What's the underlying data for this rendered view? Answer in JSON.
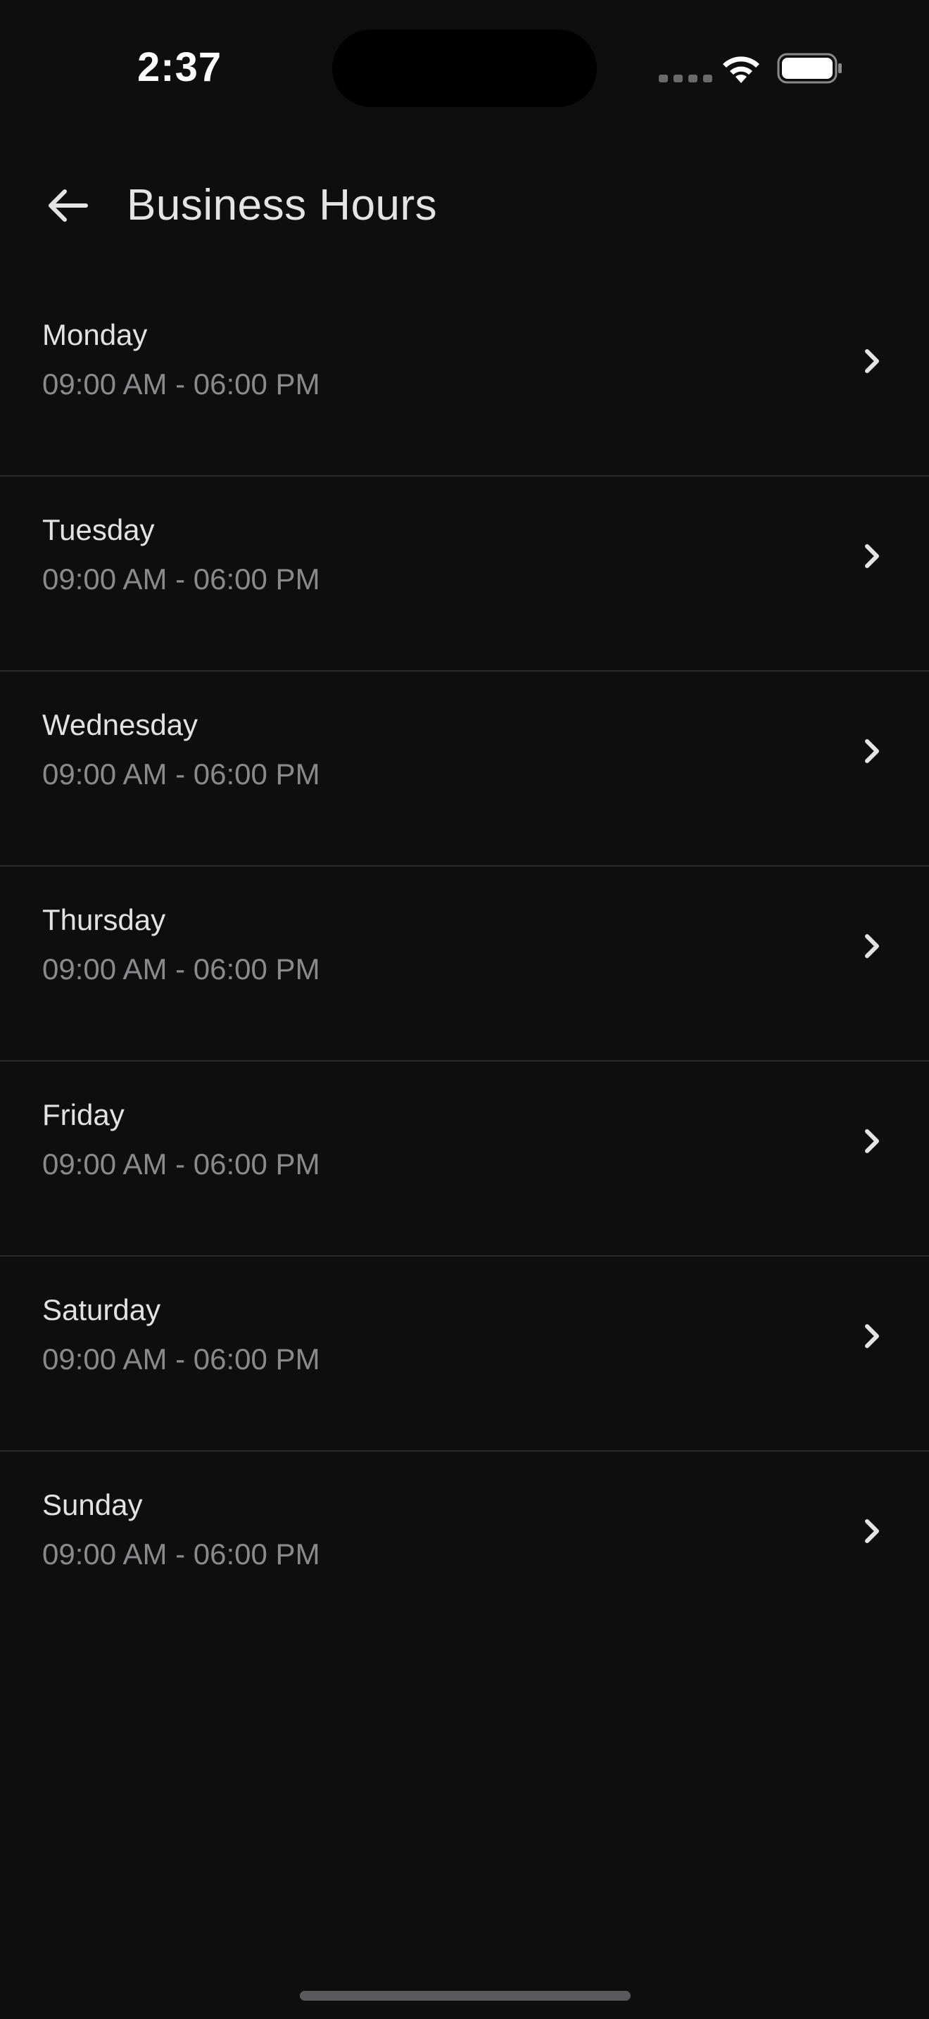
{
  "status_bar": {
    "time": "2:37"
  },
  "header": {
    "title": "Business Hours",
    "back_icon": "arrow-left-icon"
  },
  "days": [
    {
      "name": "Monday",
      "hours": "09:00 AM - 06:00 PM"
    },
    {
      "name": "Tuesday",
      "hours": "09:00 AM - 06:00 PM"
    },
    {
      "name": "Wednesday",
      "hours": "09:00 AM - 06:00 PM"
    },
    {
      "name": "Thursday",
      "hours": "09:00 AM - 06:00 PM"
    },
    {
      "name": "Friday",
      "hours": "09:00 AM - 06:00 PM"
    },
    {
      "name": "Saturday",
      "hours": "09:00 AM - 06:00 PM"
    },
    {
      "name": "Sunday",
      "hours": "09:00 AM - 06:00 PM"
    }
  ],
  "colors": {
    "background": "#0e0e0f",
    "primary_text": "#e2e2e2",
    "secondary_text": "#8a8a8c",
    "divider": "#2a2a2c"
  }
}
